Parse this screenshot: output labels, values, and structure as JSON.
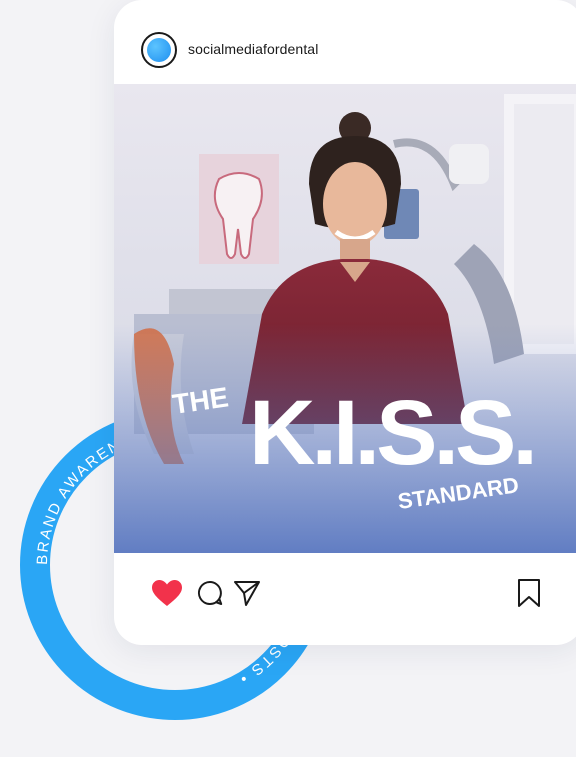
{
  "post": {
    "username": "socialmediafordental",
    "liked": true,
    "image_overlay": {
      "word1": "THE",
      "word2": "K.I.S.S.",
      "word3": "STANDARD"
    }
  },
  "badge": {
    "ring_text": "BRAND AWARENESS POSTS • BRAND AWARENESS POSTS • "
  },
  "colors": {
    "background": "#f3f3f6",
    "ring_accent": "#2aa6f5",
    "heart": "#f2324b",
    "avatar_blue": "#1e8ff0"
  },
  "icons": {
    "like": "heart-icon",
    "comment": "comment-icon",
    "share": "send-icon",
    "save": "bookmark-icon"
  }
}
